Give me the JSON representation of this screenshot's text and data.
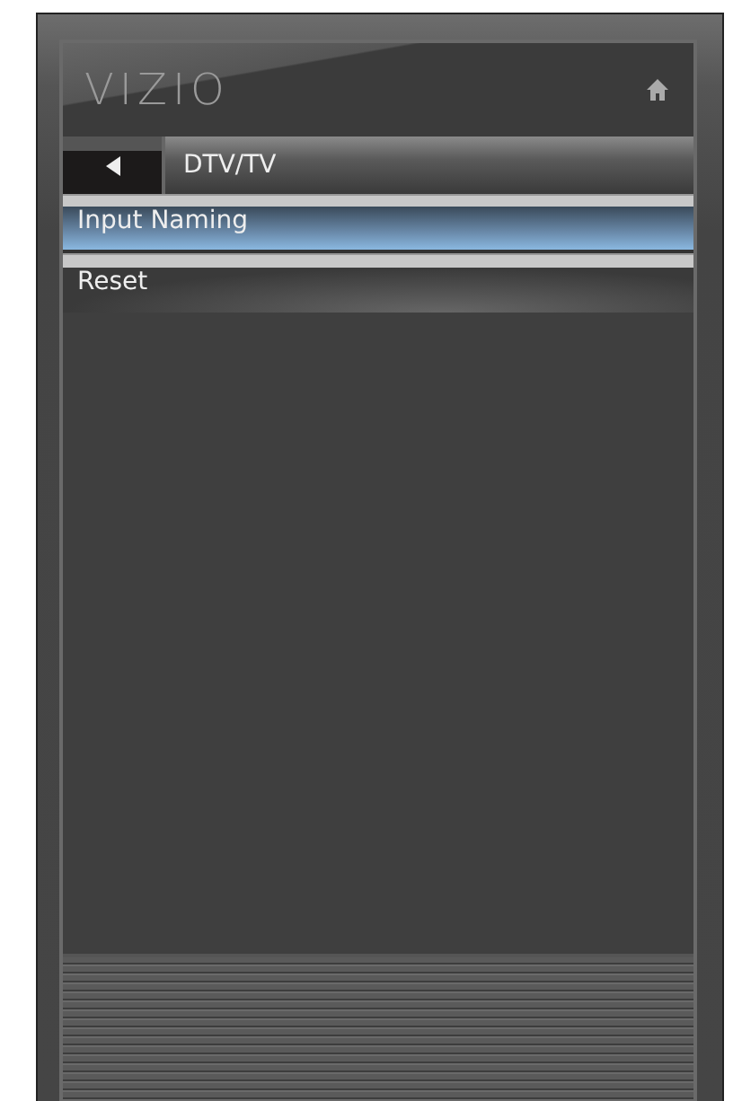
{
  "header": {
    "logo": "VIZIO"
  },
  "nav": {
    "title": "DTV/TV"
  },
  "menu": [
    {
      "label": "Input Naming",
      "selected": true
    },
    {
      "label": "Reset",
      "selected": false
    }
  ]
}
